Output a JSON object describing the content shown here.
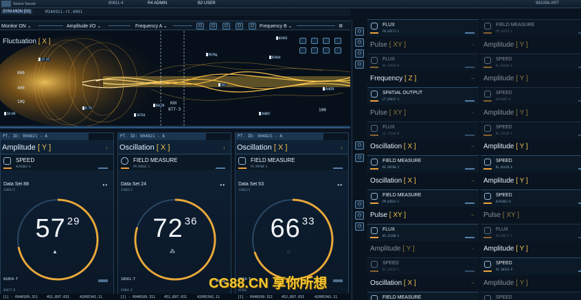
{
  "topbar": {
    "source_label": "Source Secure",
    "code_a": "80811-4",
    "r4_admin": "R4 ADMIN",
    "b2_user": "B2 USER",
    "code_right": "981056-XRT"
  },
  "sysbar": {
    "sys_id": "SYM-MON [02]",
    "serial": "M340911-rt.4091"
  },
  "controls": {
    "monitor": "Monitor ON",
    "amplitude": "Amplitude I/O",
    "frequency_a": "Frequency A",
    "frequency_b": "Frequency B"
  },
  "viz": {
    "title_prefix": "Fluctuation",
    "title_key": "[ X ]",
    "axis_ticks": [
      "800",
      "400",
      "10Q",
      "100"
    ],
    "km_label": "KM",
    "km_value": "877-3",
    "tags": [
      "9k70g",
      "02493",
      "19.05",
      "34-09",
      "6kL28",
      "1k72d",
      "R.T9",
      "36807",
      "5W1",
      "8lK4d",
      "6e019"
    ]
  },
  "panels": [
    {
      "pid": "PT. ID: 904821 - A",
      "title": "Amplitude",
      "key": "[ Y ]",
      "sub_label": "SPEED",
      "sub_code": "AL91662-6",
      "dataset": "Data Set 88",
      "dataset_sub": "11881/5",
      "value_major": "57",
      "value_minor": "29",
      "progress": 0.72,
      "footer_id": "81854-T",
      "footer_code": "8G677-B",
      "icon": "pin-icon"
    },
    {
      "pid": "PT. ID: 904821 - A",
      "title": "Oscillation",
      "key": "[ X ]",
      "sub_label": "FIELD MEASURE",
      "sub_code": "FM.93561-1",
      "dataset": "Data Set 24",
      "dataset_sub": "11881/5",
      "value_major": "72",
      "value_minor": "36",
      "progress": 0.8,
      "footer_id": "18561-T",
      "footer_code": "92082-E",
      "icon": "nodes-icon"
    },
    {
      "pid": "PT. ID: 904821 - A",
      "title": "Oscillation",
      "key": "[ X ]",
      "sub_label": "FIELD MEASURE",
      "sub_code": "FU.99768-3",
      "dataset": "Data Set 53",
      "dataset_sub": "11881/5",
      "value_major": "66",
      "value_minor": "33",
      "progress": 0.7,
      "footer_id": "8154-T",
      "footer_code": "81583",
      "icon": "bulb-icon"
    }
  ],
  "coords": {
    "c1": "[1] - 0948109.311",
    "c2": "452,897.031",
    "c3": "42095342.11",
    "c4": "[1] - 0948109.311",
    "c5": "452,897.031",
    "c6": "42095342.11",
    "c7": "[1] - 0948109.311",
    "c8": "452,897.031",
    "c9": "42095342.11"
  },
  "right_col1": [
    {
      "title": "",
      "key": "",
      "sub_label": "FLUX",
      "sub_code": "FB.03571-1"
    },
    {
      "title": "Pulse",
      "key": "[ XY ]",
      "sub_label": "FLUX",
      "sub_code": "KS.11924-B",
      "dim": true
    },
    {
      "title": "Frequency",
      "key": "[ Z ]",
      "sub_label": "SPATIAL OUTPUT",
      "sub_code": "LT.83437-3"
    },
    {
      "title": "Pulse",
      "key": "[ XY ]",
      "sub_label": "FLUX",
      "sub_code": "LG.71526-B",
      "dim": true
    },
    {
      "title": "Oscillation",
      "key": "[ X ]",
      "sub_label": "FIELD MEASURE",
      "sub_code": "KE.99768-3"
    },
    {
      "title": "Oscillation",
      "key": "[ X ]",
      "sub_label": "FIELD MEASURE",
      "sub_code": "FM.03561-1"
    },
    {
      "title": "Pulse",
      "key": "[ XY ]",
      "sub_label": "FLUX",
      "sub_code": "KA.21168-3"
    },
    {
      "title": "Amplitude",
      "key": "[ Y ]",
      "sub_label": "SPEED",
      "sub_code": "DC.45223-1",
      "dim": true
    },
    {
      "title": "Oscillation",
      "key": "[ X ]",
      "sub_label": "FIELD MEASURE",
      "sub_code": ""
    }
  ],
  "right_col2": [
    {
      "title": "",
      "key": "",
      "sub_label": "FIELD MEASURE",
      "sub_code": "FM.43257-1",
      "dim": true
    },
    {
      "title": "Amplitude",
      "key": "[ Y ]",
      "sub_label": "SPEED",
      "sub_code": "RL.81428-6",
      "dim": true
    },
    {
      "title": "Amplitude",
      "key": "[ Y ]",
      "sub_label": "SPEED",
      "sub_code": "AL91662-6",
      "dim": true
    },
    {
      "title": "Amplitude",
      "key": "[ Y ]",
      "sub_label": "SPEED",
      "sub_code": "DC.45226-1",
      "dim": true
    },
    {
      "title": "Amplitude",
      "key": "[ Y ]",
      "sub_label": "SPEED",
      "sub_code": "RL.81428-6"
    },
    {
      "title": "Amplitude",
      "key": "[ Y ]",
      "sub_label": "SPEED",
      "sub_code": "AL91662-6"
    },
    {
      "title": "Pulse",
      "key": "[ XY ]",
      "sub_label": "FLUX",
      "sub_code": "FN.93571-1",
      "dim": true
    },
    {
      "title": "Amplitude",
      "key": "[ Y ]",
      "sub_label": "SPEED",
      "sub_code": "VI.38153-9"
    },
    {
      "title": "Amplitude",
      "key": "[ Y ]",
      "sub_label": "SPEED",
      "sub_code": "",
      "dim": true
    }
  ],
  "watermark": "CG88.CN 享你所想",
  "colors": {
    "accent": "#f2c14e",
    "arrow": "#f2a23a",
    "panel_bg": "#0f2236",
    "ring": "#e9a83a"
  }
}
